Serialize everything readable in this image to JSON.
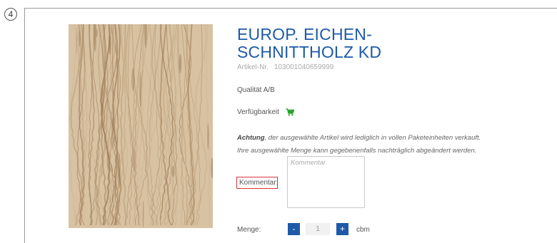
{
  "step": {
    "number": "4"
  },
  "product": {
    "title_line1": "EUROP. EICHEN-",
    "title_line2": "SCHNITTHOLZ KD",
    "article_label": "Artikel-Nr.",
    "article_number": "103001040659999",
    "quality": "Qualität A/B",
    "availability_label": "Verfügbarkeit",
    "availability_icon": "cart-icon",
    "availability_color": "#2aa52a"
  },
  "notice": {
    "emphasis": "Achtung",
    "line1_rest": ", der ausgewählte Artikel wird lediglich in vollen Paketeinheiten verkauft.",
    "line2": "Ihre ausgewählte Menge kann gegebenenfalls nachträglich abgeändert werden."
  },
  "comment": {
    "label": "Kommentar:",
    "placeholder": "Kommentar",
    "value": ""
  },
  "quantity": {
    "label": "Menge:",
    "minus": "-",
    "plus": "+",
    "value": "1",
    "unit": "cbm"
  },
  "colors": {
    "accent": "#1e5aa8",
    "highlight_border": "#d9363e"
  }
}
